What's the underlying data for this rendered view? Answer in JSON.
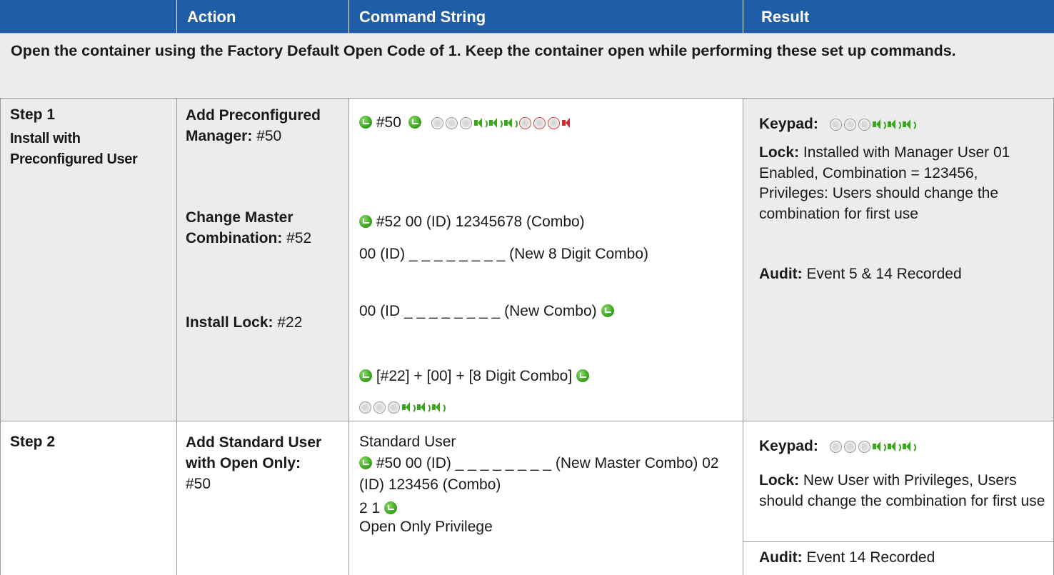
{
  "header": {
    "col1": "",
    "col2": "Action",
    "col3": "Command String",
    "col4": "Result"
  },
  "intro": "Open the container using the Factory Default Open Code of 1.  Keep the container open while performing these set up commands.",
  "rows": [
    {
      "step_label": "Step 1",
      "step_sub": "Install with Preconfigured User",
      "actions": [
        {
          "label": "Add Preconfigured Manager:",
          "code": "#50"
        },
        {
          "label": "Change Master Combination:",
          "code": "#52"
        },
        {
          "label": "Install Lock:",
          "code": "#22"
        }
      ],
      "commands": {
        "line1": "#50",
        "line2": "#52 00 (ID) 12345678 (Combo)",
        "line3": "00 (ID) _ _ _ _ _ _ _ _ (New 8 Digit Combo)",
        "line4": "00 (ID _ _ _ _ _ _ _ _ (New Combo)",
        "line5": "[#22] + [00] + [8 Digit Combo]"
      },
      "result": {
        "keypad_label": "Keypad:",
        "lock_label": "Lock:",
        "lock_text": "Installed with Manager User 01 Enabled, Combination = 123456, Privileges: Users should change the combination for first use",
        "audit_label": "Audit:",
        "audit_text": "Event 5 & 14 Recorded"
      }
    },
    {
      "step_label": "Step 2",
      "actions": [
        {
          "label": "Add Standard User with Open Only:",
          "code": "#50"
        }
      ],
      "commands": {
        "line1": "Standard User",
        "line2": "#50  00 (ID) _ _ _ _ _ _ _ _ (New Master Combo) 02 (ID)  123456 (Combo)",
        "line3": "2  1",
        "line4": "Open Only Privilege"
      },
      "result": {
        "keypad_label": "Keypad:",
        "lock_label": "Lock:",
        "lock_text": "New User with Privileges, Users should change the combination for first use",
        "audit_label": "Audit:",
        "audit_text": "Event 14 Recorded"
      }
    }
  ],
  "icons": {
    "enter": "green-enter-icon",
    "keypress": "keypress-icon",
    "beep_ok": "green-beep-icon",
    "beep_err": "red-beep-icon"
  },
  "colors": {
    "header_bg": "#1f5da6",
    "shade": "#ececec",
    "ok_green": "#3aa71f",
    "err_red": "#d42a2a"
  }
}
